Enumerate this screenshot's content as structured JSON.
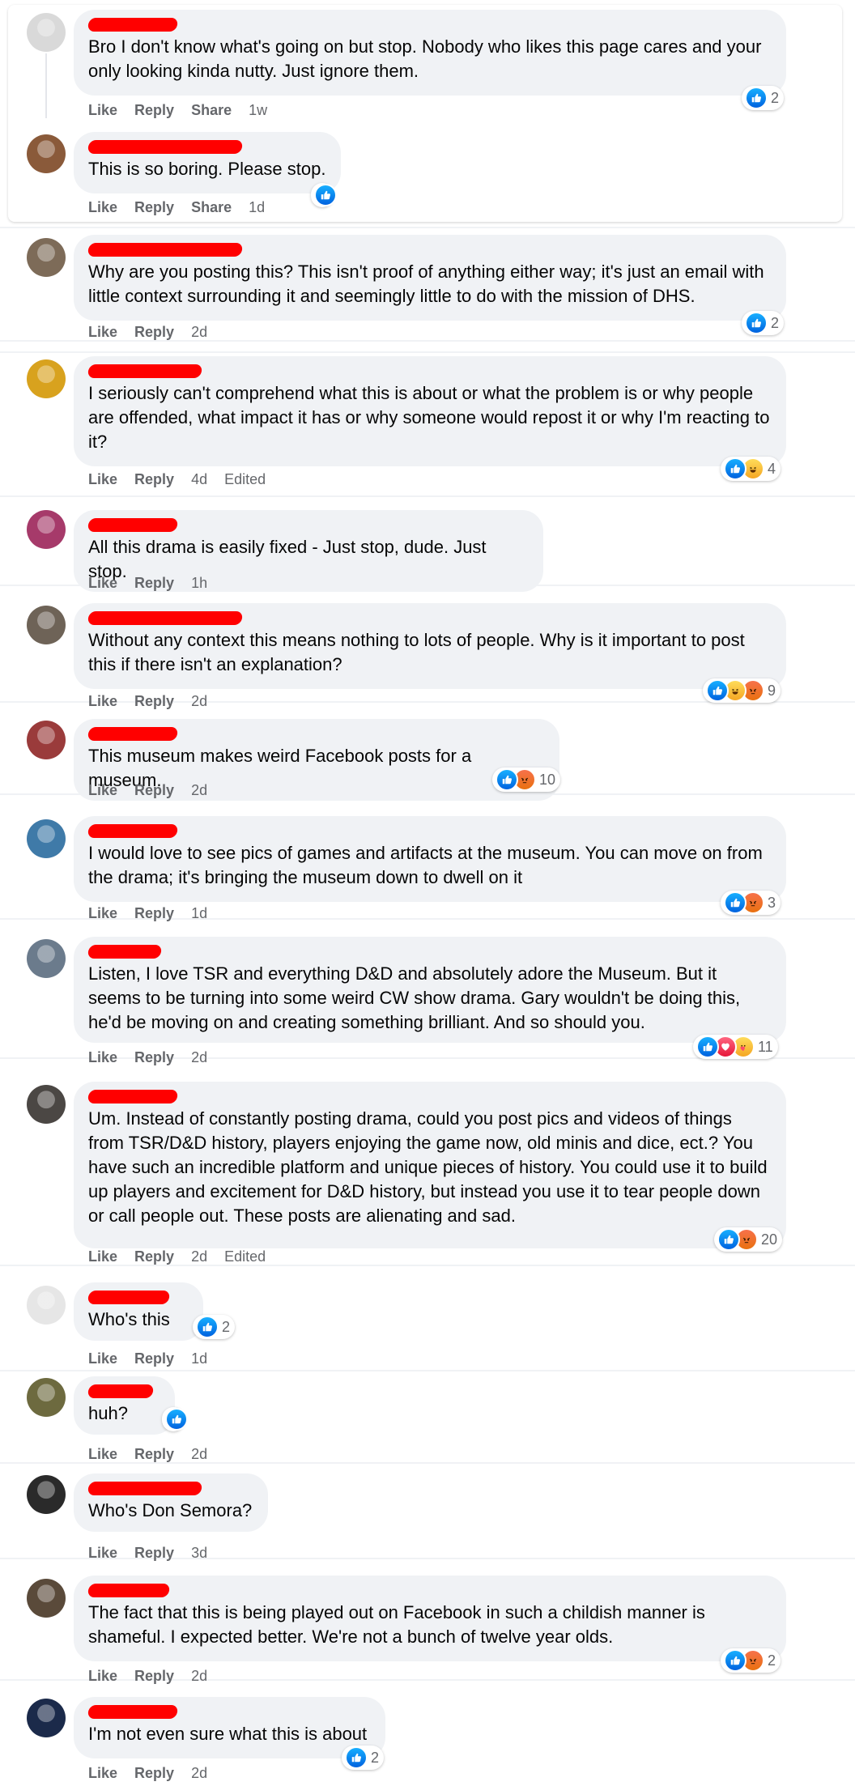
{
  "labels": {
    "like": "Like",
    "reply": "Reply",
    "share": "Share",
    "edited": "Edited"
  },
  "comments": [
    {
      "text": "Bro I don't know what's going on but stop. Nobody who likes this page cares and your only looking kinda nutty. Just ignore them.",
      "time": "1w",
      "share": true,
      "edited": false,
      "reactions": [
        "like"
      ],
      "count": "2"
    },
    {
      "text": "This is so boring. Please stop.",
      "time": "1d",
      "share": true,
      "edited": false,
      "reactions": [
        "like"
      ],
      "count": ""
    },
    {
      "text": "Why are you posting this? This isn't proof of anything either way; it's just an email with little context surrounding it and seemingly little to do with the mission of DHS.",
      "time": "2d",
      "share": false,
      "edited": false,
      "reactions": [
        "like"
      ],
      "count": "2"
    },
    {
      "text": "I seriously can't comprehend what this is about or what the problem is or why people are offended, what impact it has or why someone would repost it or why I'm reacting to it?",
      "time": "4d",
      "share": false,
      "edited": true,
      "reactions": [
        "like",
        "haha"
      ],
      "count": "4"
    },
    {
      "text": "All this drama is easily fixed - Just stop, dude. Just stop.",
      "time": "1h",
      "share": false,
      "edited": false,
      "reactions": [],
      "count": ""
    },
    {
      "text": "Without any context this means nothing to lots of people. Why is it important to post this if there isn't an explanation?",
      "time": "2d",
      "share": false,
      "edited": false,
      "reactions": [
        "like",
        "haha",
        "angry"
      ],
      "count": "9"
    },
    {
      "text": "This museum makes weird Facebook posts for a museum.",
      "time": "2d",
      "share": false,
      "edited": false,
      "reactions": [
        "like",
        "angry"
      ],
      "count": "10"
    },
    {
      "text": "I would love to see pics of games and artifacts at the museum. You can move on from the drama; it's bringing the museum down to dwell on it",
      "time": "1d",
      "share": false,
      "edited": false,
      "reactions": [
        "like",
        "angry"
      ],
      "count": "3"
    },
    {
      "text": "Listen, I love TSR and everything D&D and absolutely adore the Museum. But it seems to be turning into some weird CW show drama. Gary wouldn't be doing this, he'd be moving on and creating something brilliant. And so should you.",
      "time": "2d",
      "share": false,
      "edited": false,
      "reactions": [
        "like",
        "love",
        "care"
      ],
      "count": "11"
    },
    {
      "text": "Um. Instead of constantly posting drama, could you post pics and videos of things from TSR/D&D history, players enjoying the game now, old minis and dice, ect.? You have such an incredible platform and unique pieces of history. You could use it to build up players and excitement for D&D history, but instead you use it to tear people down or call people out. These posts are alienating and sad.",
      "time": "2d",
      "share": false,
      "edited": true,
      "reactions": [
        "like",
        "angry"
      ],
      "count": "20"
    },
    {
      "text": "Who's this",
      "time": "1d",
      "share": false,
      "edited": false,
      "reactions": [
        "like"
      ],
      "count": "2"
    },
    {
      "text": "huh?",
      "time": "2d",
      "share": false,
      "edited": false,
      "reactions": [
        "like"
      ],
      "count": ""
    },
    {
      "text": "Who's Don Semora?",
      "time": "3d",
      "share": false,
      "edited": false,
      "reactions": [],
      "count": ""
    },
    {
      "text": "The fact that this is being played out on Facebook in such a childish manner is shameful. I expected better. We're not a bunch of twelve year olds.",
      "time": "2d",
      "share": false,
      "edited": false,
      "reactions": [
        "like",
        "angry"
      ],
      "count": "2"
    },
    {
      "text": "I'm not even sure what this is about",
      "time": "2d",
      "share": false,
      "edited": false,
      "reactions": [
        "like"
      ],
      "count": "2"
    }
  ]
}
